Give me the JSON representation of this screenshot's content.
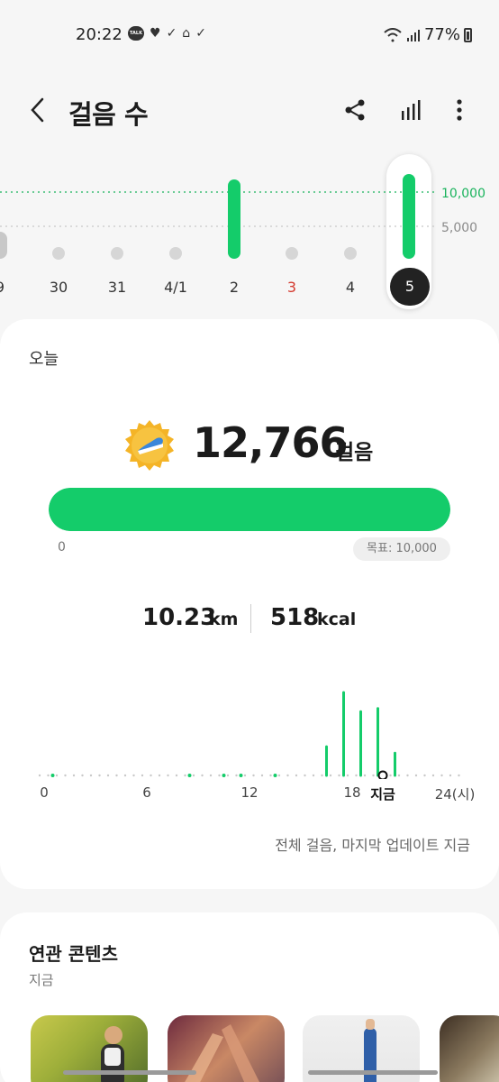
{
  "status_bar": {
    "time": "20:22",
    "battery": "77%"
  },
  "header": {
    "title": "걸음 수"
  },
  "week_chart": {
    "goal_label": "10,000",
    "half_label": "5,000",
    "days": [
      "9",
      "30",
      "31",
      "4/1",
      "2",
      "3",
      "4",
      "5"
    ],
    "selected_day": "5",
    "day_steps": [
      null,
      0,
      0,
      0,
      10500,
      0,
      0,
      12766
    ],
    "accent_color": "#14cc6a",
    "holiday_color": "#d43a2f"
  },
  "today": {
    "label": "오늘",
    "steps": "12,766",
    "steps_unit": "걸음",
    "progress_fraction": 1.0,
    "progress_start": "0",
    "goal": "목표: 10,000",
    "distance_value": "10.23",
    "distance_unit": "km",
    "calories_value": "518",
    "calories_unit": "kcal",
    "hour_ticks": [
      "0",
      "6",
      "12",
      "18",
      "지금",
      "24(시)"
    ],
    "update_text": "전체 걸음, 마지막 업데이트 지금"
  },
  "related": {
    "title": "연관 콘텐츠",
    "subtitle": "지금"
  },
  "chart_data": {
    "type": "bar",
    "x": [
      0,
      1,
      2,
      3,
      4,
      5,
      6,
      7,
      8,
      9,
      10,
      11,
      12,
      13,
      14,
      15,
      16,
      17,
      18,
      19,
      20
    ],
    "values": [
      1,
      0,
      0,
      0,
      0,
      0,
      0,
      0,
      1,
      0,
      1,
      1,
      0,
      1,
      0,
      0,
      18,
      52,
      40,
      42,
      14
    ],
    "xlabel": "",
    "ylabel": "",
    "tick_labels": [
      "0",
      "6",
      "12",
      "18",
      "지금",
      "24(시)"
    ],
    "xlim": [
      0,
      24
    ]
  }
}
